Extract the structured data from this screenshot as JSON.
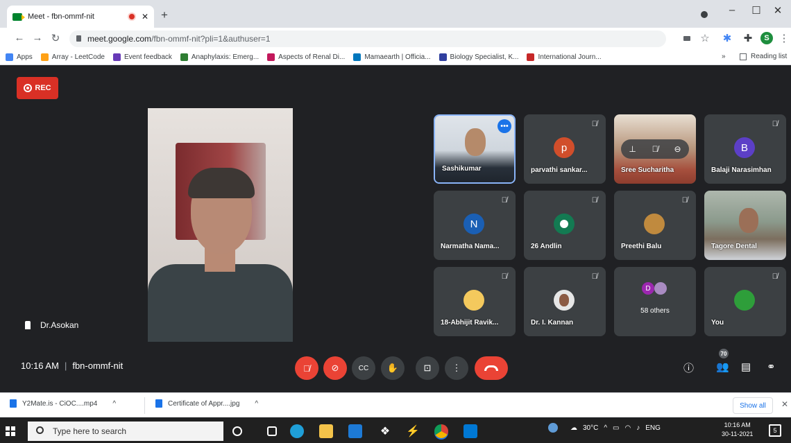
{
  "browser": {
    "tab_title": "Meet - fbn-ommf-nit",
    "url_host": "meet.google.com",
    "url_path": "/fbn-ommf-nit?pli=1&authuser=1",
    "profile_initial": "S",
    "reading_list": "Reading list",
    "bookmarks": [
      {
        "label": "Apps",
        "color": "#4285f4"
      },
      {
        "label": "Array - LeetCode",
        "color": "#ffa116"
      },
      {
        "label": "Event feedback",
        "color": "#673ab7"
      },
      {
        "label": "Anaphylaxis: Emerg...",
        "color": "#2e7d32"
      },
      {
        "label": "Aspects of Renal Di...",
        "color": "#c2185b"
      },
      {
        "label": "Mamaearth | Officia...",
        "color": "#0277bd"
      },
      {
        "label": "Biology Specialist, K...",
        "color": "#303f9f"
      },
      {
        "label": "International Journ...",
        "color": "#c62828"
      }
    ]
  },
  "meeting": {
    "rec_label": "REC",
    "main_speaker": "Dr.Asokan",
    "time": "10:16 AM",
    "code": "fbn-ommf-nit",
    "participant_count": "70",
    "tiles": [
      {
        "name": "Sashikumar",
        "kind": "photo",
        "bg": "#6f7f8f"
      },
      {
        "name": "parvathi sankar...",
        "kind": "avatar",
        "initial": "p",
        "color": "#d14e2b"
      },
      {
        "name": "Sree Sucharitha",
        "kind": "photo",
        "bg": "#b79478"
      },
      {
        "name": "Balaji Narasimhan",
        "kind": "avatar",
        "initial": "B",
        "color": "#5c3fc7"
      },
      {
        "name": "Narmatha Nama...",
        "kind": "avatar",
        "initial": "N",
        "color": "#1a5fb4"
      },
      {
        "name": "26 Andlin",
        "kind": "avatar",
        "initial": "",
        "color": "#137a52"
      },
      {
        "name": "Preethi Balu",
        "kind": "avatar",
        "initial": "",
        "color": "#c08a3e"
      },
      {
        "name": "Tagore Dental",
        "kind": "photo",
        "bg": "#8a9a8a"
      },
      {
        "name": "18-Abhijit Ravik...",
        "kind": "avatar",
        "initial": "",
        "color": "#f4c95d"
      },
      {
        "name": "Dr. I. Kannan",
        "kind": "avatar",
        "initial": "",
        "color": "#e6e6e6"
      },
      {
        "name": "58 others",
        "kind": "others",
        "initial": "D",
        "color": "#9c27b0"
      },
      {
        "name": "You",
        "kind": "avatar",
        "initial": "",
        "color": "#2e9e3a"
      }
    ]
  },
  "downloads": {
    "items": [
      "Y2Mate.is - CiOC....mp4",
      "Certificate of Appr....jpg"
    ],
    "show_all": "Show all"
  },
  "taskbar": {
    "search_placeholder": "Type here to search",
    "weather": "30°C",
    "lang": "ENG",
    "time": "10:16 AM",
    "date": "30-11-2021",
    "notif": "5"
  }
}
